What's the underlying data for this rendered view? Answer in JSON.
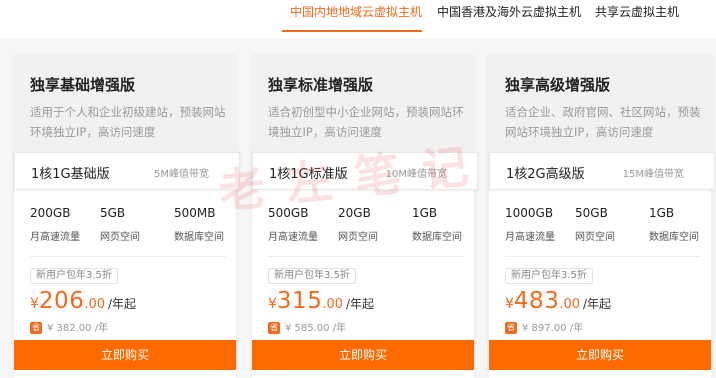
{
  "tabs": [
    {
      "label": "中国内地地域云虚拟主机",
      "active": true
    },
    {
      "label": "中国香港及海外云虚拟主机",
      "active": false
    },
    {
      "label": "共享云虚拟主机",
      "active": false
    }
  ],
  "accent_color": "#f26b1d",
  "buy_button_color": "#ff6a00",
  "watermark": "老左笔记",
  "cards": [
    {
      "title": "独享基础增强版",
      "desc": "适用于个人和企业初级建站，预装网站环境独立IP，高访问速度",
      "spec_name": "1核1G基础版",
      "bandwidth": "5M峰值带宽",
      "stats": [
        {
          "value": "200GB",
          "label": "月高速流量"
        },
        {
          "value": "5GB",
          "label": "网页空间"
        },
        {
          "value": "500MB",
          "label": "数据库空间"
        }
      ],
      "promo": "新用户包年3.5折",
      "currency": "¥",
      "price_int": "206",
      "price_dec": ".00",
      "price_unit": "/年起",
      "sheng": "省",
      "orig_price": "¥ 382.00 /年",
      "buy_label": "立即购买"
    },
    {
      "title": "独享标准增强版",
      "desc": "适合初创型中小企业网站，预装网站环境独立IP，高访问速度",
      "spec_name": "1核1G标准版",
      "bandwidth": "10M峰值带宽",
      "stats": [
        {
          "value": "500GB",
          "label": "月高速流量"
        },
        {
          "value": "20GB",
          "label": "网页空间"
        },
        {
          "value": "1GB",
          "label": "数据库空间"
        }
      ],
      "promo": "新用户包年3.5折",
      "currency": "¥",
      "price_int": "315",
      "price_dec": ".00",
      "price_unit": "/年起",
      "sheng": "省",
      "orig_price": "¥ 585.00 /年",
      "buy_label": "立即购买"
    },
    {
      "title": "独享高级增强版",
      "desc": "适合企业、政府官网、社区网站，预装网站环境独立IP，高访问速度",
      "spec_name": "1核2G高级版",
      "bandwidth": "15M峰值带宽",
      "stats": [
        {
          "value": "1000GB",
          "label": "月高速流量"
        },
        {
          "value": "50GB",
          "label": "网页空间"
        },
        {
          "value": "1GB",
          "label": "数据库空间"
        }
      ],
      "promo": "新用户包年3.5折",
      "currency": "¥",
      "price_int": "483",
      "price_dec": ".00",
      "price_unit": "/年起",
      "sheng": "省",
      "orig_price": "¥ 897.00 /年",
      "buy_label": "立即购买"
    }
  ]
}
